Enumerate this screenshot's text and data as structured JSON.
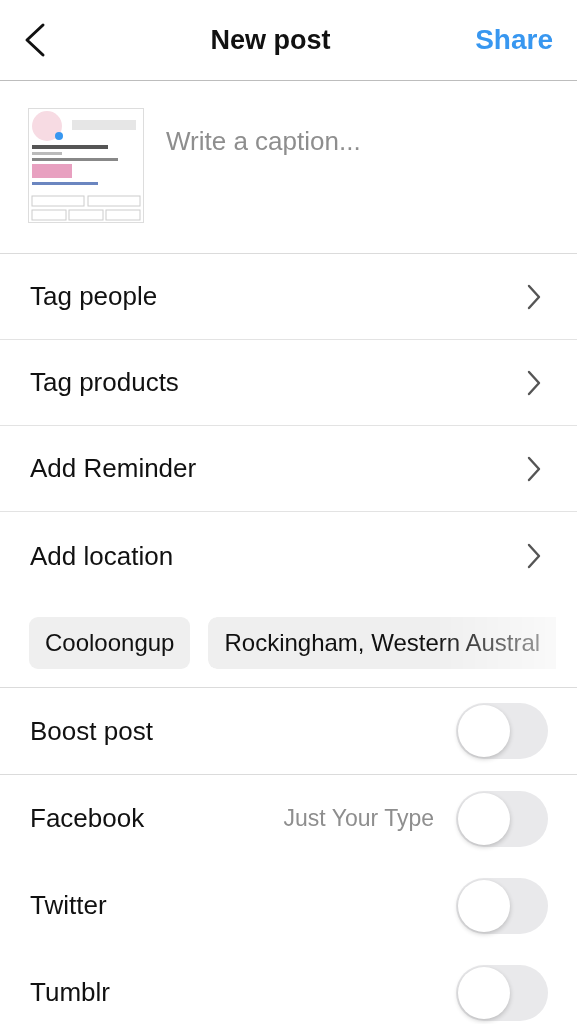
{
  "header": {
    "title": "New post",
    "action": "Share"
  },
  "caption": {
    "placeholder": "Write a caption..."
  },
  "options": [
    {
      "label": "Tag people"
    },
    {
      "label": "Tag products"
    },
    {
      "label": "Add Reminder"
    },
    {
      "label": "Add location"
    }
  ],
  "location_suggestions": [
    {
      "label": "Cooloongup"
    },
    {
      "label": "Rockingham, Western Austral"
    }
  ],
  "boost": {
    "label": "Boost post",
    "on": false
  },
  "share_to": [
    {
      "label": "Facebook",
      "account": "Just Your Type",
      "on": false
    },
    {
      "label": "Twitter",
      "on": false
    },
    {
      "label": "Tumblr",
      "on": false
    }
  ]
}
